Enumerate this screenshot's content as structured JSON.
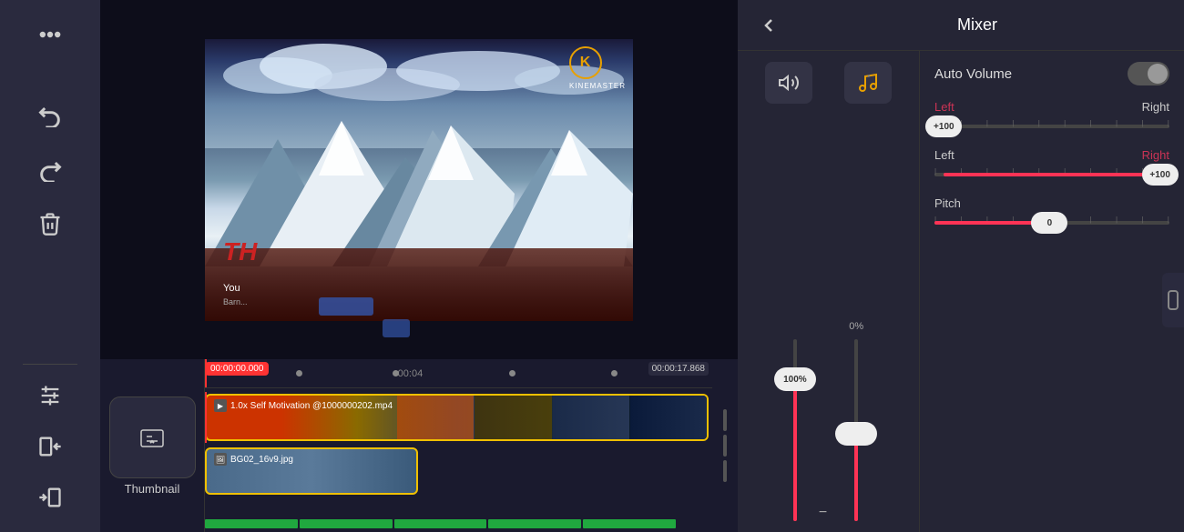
{
  "app": {
    "title": "KineMaster"
  },
  "toolbar": {
    "more_label": "···",
    "undo_label": "↺",
    "redo_label": "↻",
    "delete_label": "🗑",
    "layer_label": "⊞",
    "insert_label": "⊣",
    "append_label": "⊢"
  },
  "preview": {
    "logo_letter": "K",
    "logo_text": "KINEMASTER",
    "text_overlay": "TH",
    "subtitle": "You",
    "subtitle2": "Barn..."
  },
  "mixer": {
    "back_icon": "‹",
    "title": "Mixer",
    "auto_volume_label": "Auto Volume",
    "slider1": {
      "value": "100%",
      "percent": 100
    },
    "slider2": {
      "value": "0%",
      "percent": 0
    },
    "pan_left1": {
      "label_left": "Left",
      "label_right": "Right",
      "value": "+100",
      "position_percent": 100
    },
    "pan_left2": {
      "label_left": "Left",
      "label_right": "Right",
      "value": "+100",
      "position_percent": 100
    },
    "pitch": {
      "label": "Pitch",
      "value": "0",
      "position_percent": 50
    }
  },
  "timeline": {
    "current_time": "00:00:00.000",
    "end_time": "00:00:17.868",
    "mid_time": "00:04",
    "video_clip_label": "1.0x Self Motivation @1000000202.mp4",
    "bg_clip_label": "BG02_16v9.jpg",
    "thumbnail_label": "Thumbnail"
  }
}
